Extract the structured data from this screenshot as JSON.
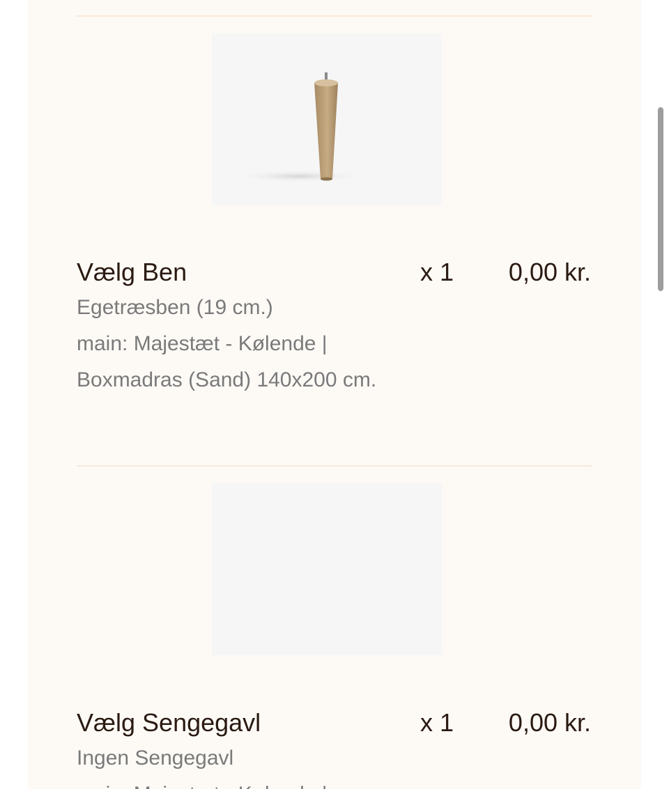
{
  "items": [
    {
      "title": "Vælg Ben",
      "quantity": "x 1",
      "price": "0,00 kr.",
      "option": "Egetræsben (19 cm.)",
      "main": "main: Majestæt - Kølende | Boxmadras (Sand) 140x200 cm.",
      "image_icon": "wooden-leg-icon"
    },
    {
      "title": "Vælg Sengegavl",
      "quantity": "x 1",
      "price": "0,00 kr.",
      "option": "Ingen Sengegavl",
      "main": "main: Majestæt - Kølende |"
    }
  ],
  "colors": {
    "panel": "#fdfaf6",
    "divider": "#f7e9d8",
    "text_primary": "#2a1a12",
    "text_secondary": "#7a7a7a",
    "thumb_bg": "#f6f6f7"
  }
}
